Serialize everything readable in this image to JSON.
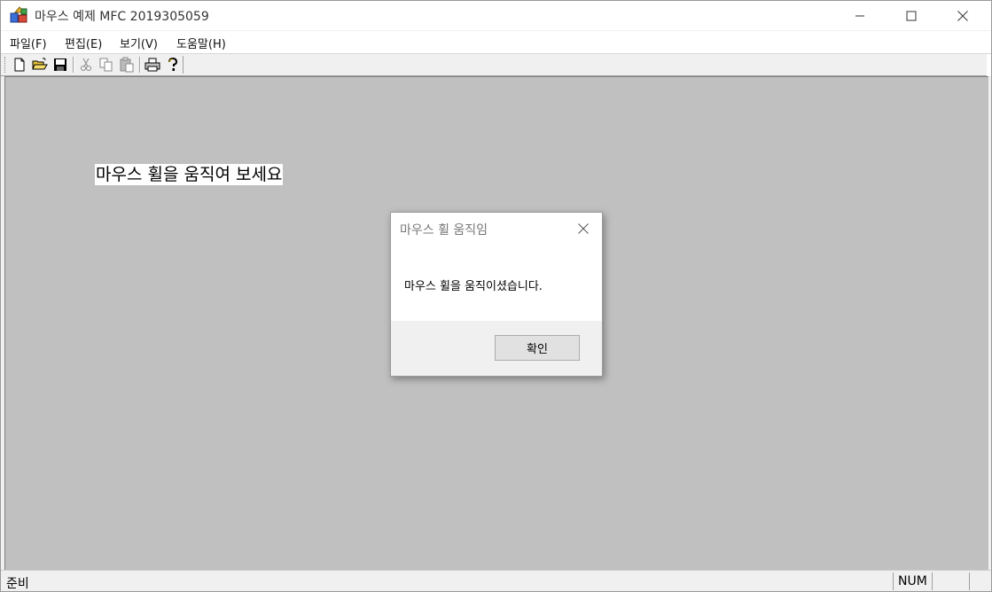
{
  "window": {
    "title": "마우스 예제 MFC 2019305059",
    "app_icon": "mfc-app-icon",
    "controls": [
      "minimize-icon",
      "maximize-icon",
      "close-icon"
    ]
  },
  "menu": {
    "items": [
      {
        "label": "파일(F)"
      },
      {
        "label": "편집(E)"
      },
      {
        "label": "보기(V)"
      },
      {
        "label": "도움말(H)"
      }
    ]
  },
  "toolbar": {
    "buttons": [
      "new-icon",
      "open-icon",
      "save-icon",
      "cut-icon",
      "copy-icon",
      "paste-icon",
      "print-icon",
      "help-icon"
    ]
  },
  "client": {
    "text": "마우스 휠을 움직여 보세요",
    "background": "#c0c0c0"
  },
  "dialog": {
    "title": "마우스 휠 움직임",
    "message": "마우스 휠을 움직이셨습니다.",
    "ok_label": "확인"
  },
  "statusbar": {
    "text": "준비",
    "num": "NUM"
  }
}
